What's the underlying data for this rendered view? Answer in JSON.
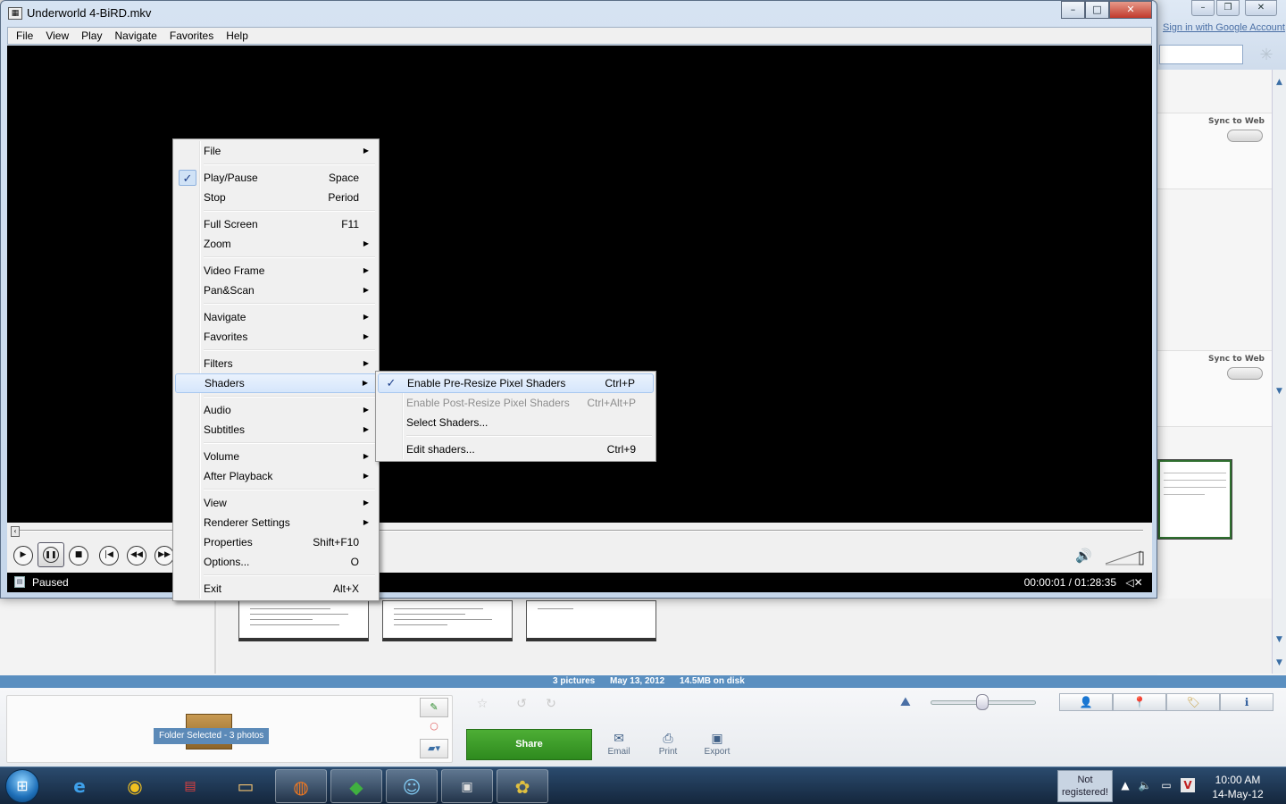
{
  "window": {
    "title": "Underworld 4-BiRD.mkv",
    "controls": {
      "minimize": "–",
      "maximize": "□",
      "close": "✕"
    },
    "menubar": [
      "File",
      "View",
      "Play",
      "Navigate",
      "Favorites",
      "Help"
    ]
  },
  "player": {
    "status": "Paused",
    "time": "00:00:01 / 01:28:35",
    "volume_icon": "speaker-icon",
    "buttons": [
      "play-icon",
      "pause-icon",
      "stop-icon",
      "skip-back-icon",
      "rewind-icon",
      "fast-forward-icon"
    ]
  },
  "context_menu": {
    "groups": [
      [
        {
          "label": "File",
          "submenu": true
        }
      ],
      [
        {
          "label": "Play/Pause",
          "shortcut": "Space",
          "checked": true
        },
        {
          "label": "Stop",
          "shortcut": "Period"
        }
      ],
      [
        {
          "label": "Full Screen",
          "shortcut": "F11"
        },
        {
          "label": "Zoom",
          "submenu": true
        }
      ],
      [
        {
          "label": "Video Frame",
          "submenu": true
        },
        {
          "label": "Pan&Scan",
          "submenu": true
        }
      ],
      [
        {
          "label": "Navigate",
          "submenu": true
        },
        {
          "label": "Favorites",
          "submenu": true
        }
      ],
      [
        {
          "label": "Filters",
          "submenu": true
        },
        {
          "label": "Shaders",
          "submenu": true,
          "highlighted": true
        }
      ],
      [
        {
          "label": "Audio",
          "submenu": true
        },
        {
          "label": "Subtitles",
          "submenu": true
        }
      ],
      [
        {
          "label": "Volume",
          "submenu": true
        },
        {
          "label": "After Playback",
          "submenu": true
        }
      ],
      [
        {
          "label": "View",
          "submenu": true
        },
        {
          "label": "Renderer Settings",
          "submenu": true
        },
        {
          "label": "Properties",
          "shortcut": "Shift+F10"
        },
        {
          "label": "Options...",
          "shortcut": "O"
        }
      ],
      [
        {
          "label": "Exit",
          "shortcut": "Alt+X"
        }
      ]
    ]
  },
  "shaders_submenu": {
    "groups": [
      [
        {
          "label": "Enable Pre-Resize Pixel Shaders",
          "shortcut": "Ctrl+P",
          "checked": true,
          "highlighted": true
        },
        {
          "label": "Enable Post-Resize Pixel Shaders",
          "shortcut": "Ctrl+Alt+P",
          "disabled": true
        },
        {
          "label": "Select Shaders..."
        }
      ],
      [
        {
          "label": "Edit shaders...",
          "shortcut": "Ctrl+9"
        }
      ]
    ]
  },
  "background_app": {
    "sign_in": "Sign in with Google Account",
    "sync_label": "Sync to Web",
    "status": {
      "pictures": "3 pictures",
      "date": "May 13, 2012",
      "size": "14.5MB on disk"
    },
    "folder_label": "Folder Selected - 3 photos",
    "share": "Share",
    "actions": [
      "Email",
      "Print",
      "Export"
    ]
  },
  "taskbar": {
    "not_registered": "Not registered!",
    "time": "10:00 AM",
    "date": "14-May-12"
  }
}
